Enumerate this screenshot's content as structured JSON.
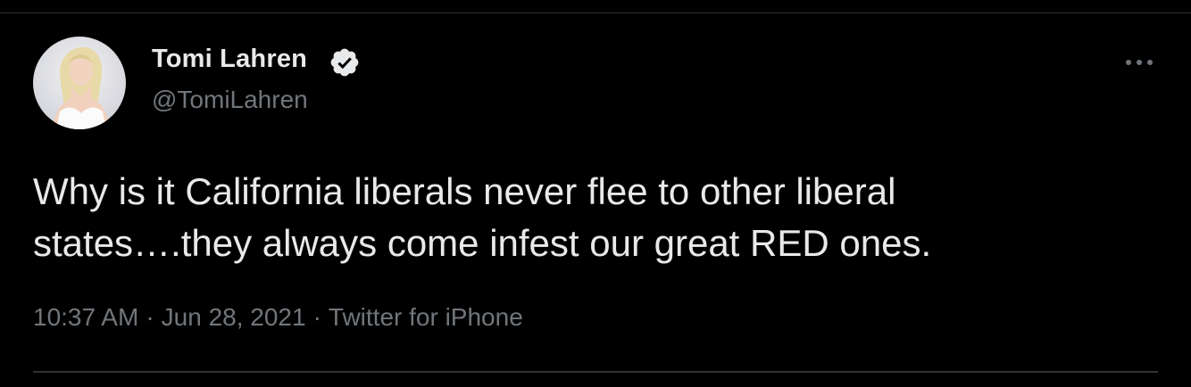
{
  "tweet": {
    "author": {
      "display_name": "Tomi Lahren",
      "handle": "@TomiLahren",
      "verified": true,
      "avatar_icon": "profile-photo"
    },
    "text_lines": [
      "Why is it California liberals never flee to other liberal",
      "states….they always come infest our great RED ones."
    ],
    "meta": {
      "time": "10:37 AM",
      "separator": "·",
      "date": "Jun 28, 2021",
      "source": "Twitter for iPhone"
    },
    "more_icon": "more-horizontal-icon"
  },
  "colors": {
    "background": "#000000",
    "primary_text": "#e7e9ea",
    "secondary_text": "#71767b",
    "divider": "#2f3336"
  }
}
